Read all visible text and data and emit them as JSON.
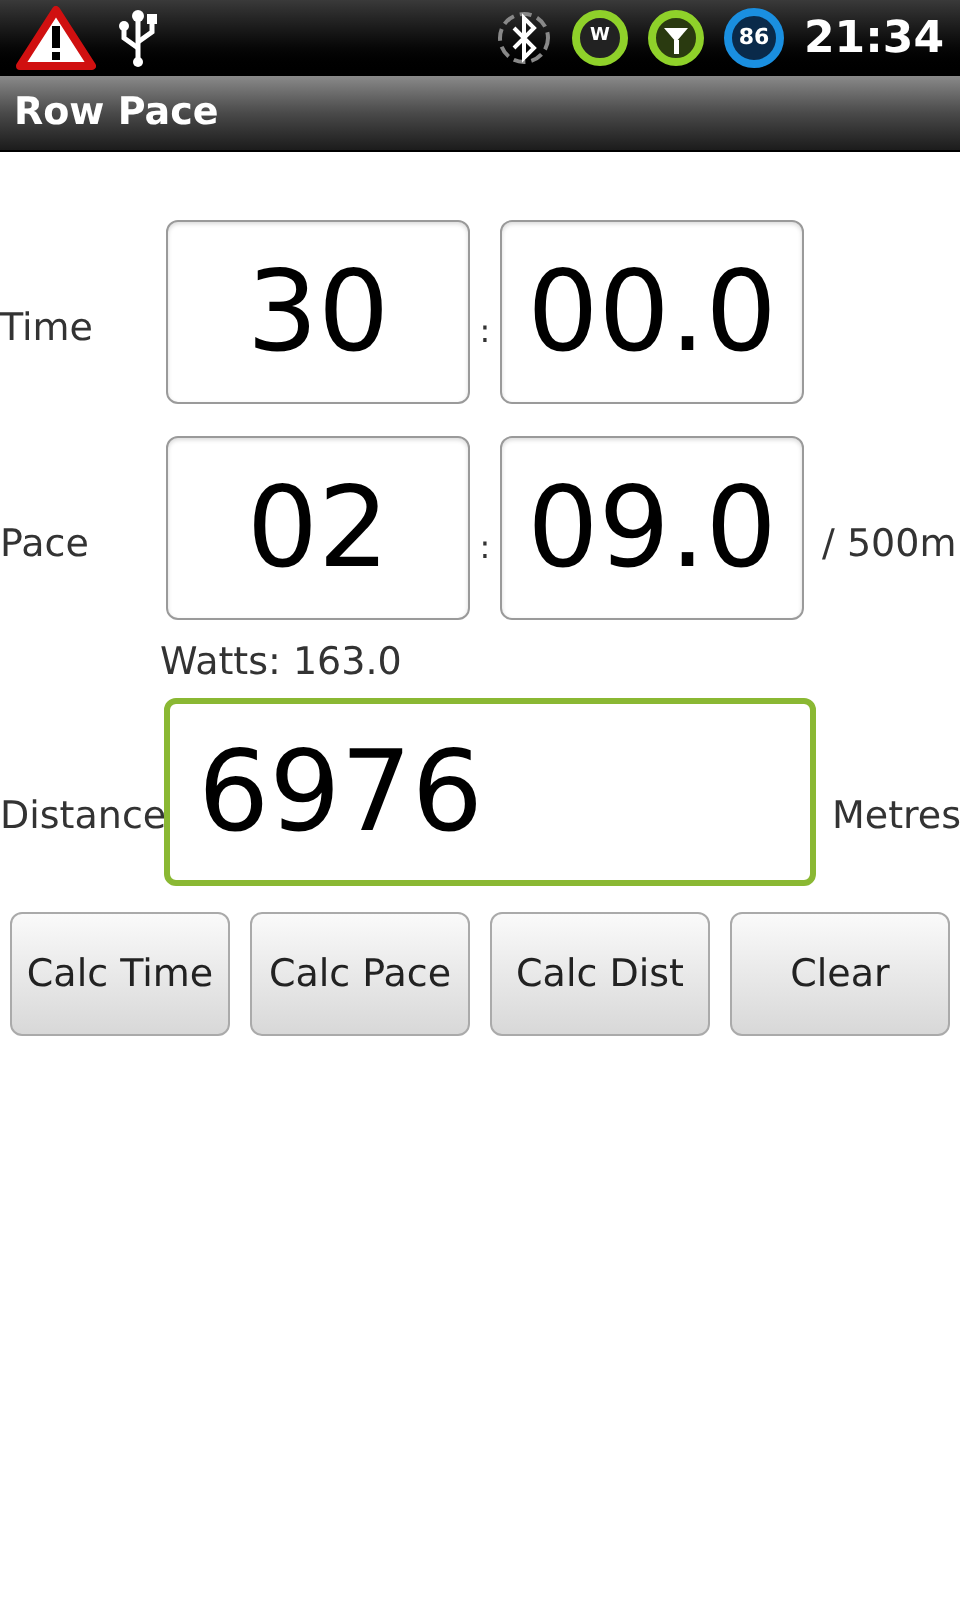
{
  "status_bar": {
    "wifi_badge": "W",
    "battery": "86",
    "time": "21:34"
  },
  "title": "Row Pace",
  "rows": [
    {
      "label": "Time",
      "minutes": "30",
      "separator": ":",
      "seconds": "00.0"
    },
    {
      "label": "Pace",
      "minutes": "02",
      "separator": ":",
      "seconds": "09.0",
      "unit": "/ 500m"
    }
  ],
  "watts": "Watts: 163.0",
  "distance": {
    "label": "Distance",
    "value": "6976",
    "unit": "Metres",
    "focused": true
  },
  "buttons": [
    "Calc Time",
    "Calc Pace",
    "Calc Dist",
    "Clear"
  ]
}
